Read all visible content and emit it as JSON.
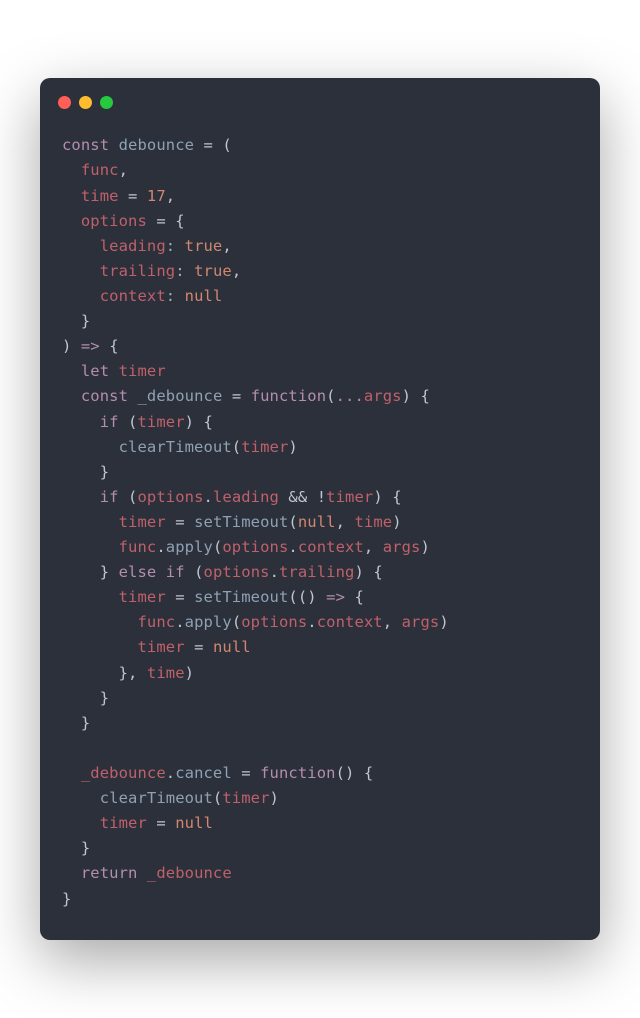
{
  "window": {
    "dots": [
      "red",
      "yellow",
      "green"
    ]
  },
  "tokens": {
    "const": "const",
    "let": "let",
    "if": "if",
    "else": "else",
    "return": "return",
    "function": "function",
    "debounce": "debounce",
    "func": "func",
    "time": "time",
    "options": "options",
    "leading": "leading",
    "trailing": "trailing",
    "context": "context",
    "true": "true",
    "null": "null",
    "num17": "17",
    "timer": "timer",
    "_debounce": "_debounce",
    "args": "args",
    "clearTimeout": "clearTimeout",
    "setTimeout": "setTimeout",
    "apply": "apply",
    "cancel": "cancel",
    "spread": "...",
    "arrow": "=>",
    "and": "&&",
    "not": "!",
    "eq": "=",
    "dot": ".",
    "comma": ",",
    "colon": ":",
    "lparen": "(",
    "rparen": ")",
    "lbrace": "{",
    "rbrace": "}"
  }
}
